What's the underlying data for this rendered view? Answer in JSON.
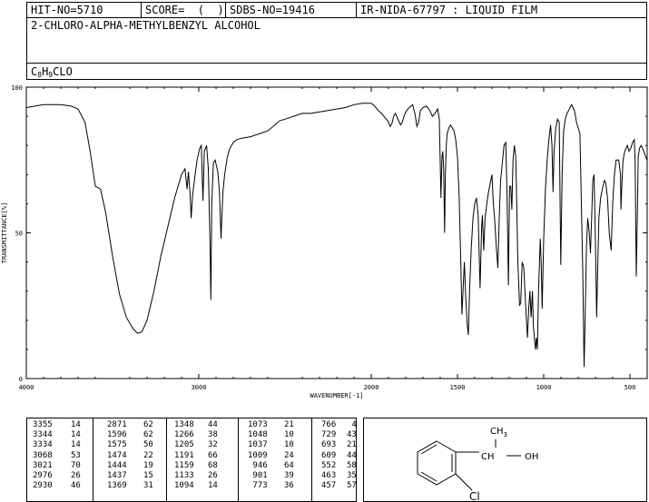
{
  "header": {
    "hit_no": "HIT-NO=5710",
    "score": "SCORE=  (  )",
    "sdbs_no": "SDBS-NO=19416",
    "ir_nida": "IR-NIDA-67797 : LIQUID FILM",
    "compound_name": "2-CHLORO-ALPHA-METHYLBENZYL ALCOHOL",
    "formula": {
      "c": "C",
      "c_count": "8",
      "h": "H",
      "h_count": "9",
      "rest": "CLO"
    }
  },
  "chart_data": {
    "type": "line",
    "xlabel": "WAVENUMBER[-1]",
    "ylabel": "TRANSMITTANCE[%]",
    "xlim": [
      4000,
      400
    ],
    "ylim": [
      0,
      100
    ],
    "x_ticks": [
      4000,
      3000,
      2000,
      1500,
      1000,
      500
    ],
    "y_ticks": [
      0,
      50,
      100
    ],
    "series": [
      {
        "points": [
          [
            4000,
            93
          ],
          [
            3900,
            94
          ],
          [
            3800,
            94
          ],
          [
            3740,
            93.5
          ],
          [
            3700,
            92.5
          ],
          [
            3660,
            88
          ],
          [
            3630,
            78
          ],
          [
            3600,
            66
          ],
          [
            3570,
            65
          ],
          [
            3540,
            57
          ],
          [
            3500,
            42
          ],
          [
            3460,
            29
          ],
          [
            3420,
            21
          ],
          [
            3380,
            17
          ],
          [
            3355,
            15.5
          ],
          [
            3330,
            16
          ],
          [
            3300,
            20
          ],
          [
            3260,
            30
          ],
          [
            3220,
            42
          ],
          [
            3180,
            52
          ],
          [
            3140,
            62
          ],
          [
            3100,
            70
          ],
          [
            3080,
            72
          ],
          [
            3068,
            65
          ],
          [
            3060,
            71
          ],
          [
            3050,
            63
          ],
          [
            3044,
            55
          ],
          [
            3036,
            63
          ],
          [
            3021,
            70
          ],
          [
            3010,
            75
          ],
          [
            2995,
            79
          ],
          [
            2985,
            80
          ],
          [
            2976,
            61
          ],
          [
            2968,
            78
          ],
          [
            2955,
            80
          ],
          [
            2945,
            72
          ],
          [
            2935,
            48
          ],
          [
            2930,
            27
          ],
          [
            2925,
            60
          ],
          [
            2915,
            74
          ],
          [
            2905,
            75
          ],
          [
            2890,
            71
          ],
          [
            2880,
            64
          ],
          [
            2871,
            48
          ],
          [
            2866,
            56
          ],
          [
            2860,
            64
          ],
          [
            2850,
            70
          ],
          [
            2835,
            76
          ],
          [
            2820,
            79
          ],
          [
            2800,
            81
          ],
          [
            2780,
            82
          ],
          [
            2750,
            82.5
          ],
          [
            2700,
            83
          ],
          [
            2650,
            84
          ],
          [
            2600,
            85
          ],
          [
            2560,
            87
          ],
          [
            2530,
            88.5
          ],
          [
            2500,
            89
          ],
          [
            2450,
            90
          ],
          [
            2400,
            91
          ],
          [
            2350,
            91
          ],
          [
            2300,
            91.5
          ],
          [
            2250,
            92
          ],
          [
            2200,
            92.5
          ],
          [
            2150,
            93
          ],
          [
            2100,
            94
          ],
          [
            2050,
            94.5
          ],
          [
            2000,
            94.5
          ],
          [
            1980,
            93.5
          ],
          [
            1960,
            92
          ],
          [
            1940,
            91
          ],
          [
            1920,
            89.5
          ],
          [
            1905,
            88.5
          ],
          [
            1890,
            86.5
          ],
          [
            1880,
            87.5
          ],
          [
            1870,
            90
          ],
          [
            1860,
            91
          ],
          [
            1845,
            89
          ],
          [
            1830,
            87
          ],
          [
            1820,
            88
          ],
          [
            1810,
            90
          ],
          [
            1800,
            91.5
          ],
          [
            1780,
            93
          ],
          [
            1760,
            94
          ],
          [
            1745,
            90.5
          ],
          [
            1735,
            86.5
          ],
          [
            1725,
            88
          ],
          [
            1715,
            92
          ],
          [
            1700,
            93
          ],
          [
            1680,
            93.5
          ],
          [
            1660,
            92
          ],
          [
            1645,
            90
          ],
          [
            1630,
            91
          ],
          [
            1615,
            92.5
          ],
          [
            1605,
            89
          ],
          [
            1596,
            62
          ],
          [
            1590,
            76
          ],
          [
            1585,
            78
          ],
          [
            1580,
            72
          ],
          [
            1575,
            50
          ],
          [
            1570,
            70
          ],
          [
            1565,
            80
          ],
          [
            1560,
            84
          ],
          [
            1550,
            86
          ],
          [
            1540,
            87
          ],
          [
            1530,
            86
          ],
          [
            1520,
            85
          ],
          [
            1510,
            82
          ],
          [
            1500,
            76
          ],
          [
            1490,
            62
          ],
          [
            1480,
            38
          ],
          [
            1474,
            22
          ],
          [
            1468,
            30
          ],
          [
            1460,
            40
          ],
          [
            1452,
            28
          ],
          [
            1444,
            19
          ],
          [
            1437,
            15
          ],
          [
            1430,
            30
          ],
          [
            1420,
            45
          ],
          [
            1410,
            55
          ],
          [
            1400,
            60
          ],
          [
            1390,
            62
          ],
          [
            1380,
            56
          ],
          [
            1369,
            31
          ],
          [
            1360,
            52
          ],
          [
            1355,
            56
          ],
          [
            1348,
            44
          ],
          [
            1340,
            55
          ],
          [
            1330,
            60
          ],
          [
            1320,
            64
          ],
          [
            1310,
            67
          ],
          [
            1300,
            70
          ],
          [
            1292,
            60
          ],
          [
            1285,
            55
          ],
          [
            1275,
            45
          ],
          [
            1266,
            38
          ],
          [
            1258,
            55
          ],
          [
            1250,
            68
          ],
          [
            1240,
            74
          ],
          [
            1230,
            80
          ],
          [
            1220,
            81
          ],
          [
            1212,
            62
          ],
          [
            1205,
            32
          ],
          [
            1198,
            66
          ],
          [
            1191,
            66
          ],
          [
            1185,
            58
          ],
          [
            1178,
            75
          ],
          [
            1170,
            80
          ],
          [
            1162,
            76
          ],
          [
            1159,
            68
          ],
          [
            1150,
            40
          ],
          [
            1140,
            25
          ],
          [
            1133,
            26
          ],
          [
            1125,
            40
          ],
          [
            1115,
            38
          ],
          [
            1105,
            25
          ],
          [
            1094,
            14
          ],
          [
            1087,
            24
          ],
          [
            1080,
            30
          ],
          [
            1073,
            21
          ],
          [
            1065,
            30
          ],
          [
            1060,
            18
          ],
          [
            1048,
            10
          ],
          [
            1042,
            14
          ],
          [
            1037,
            10
          ],
          [
            1030,
            30
          ],
          [
            1020,
            48
          ],
          [
            1015,
            40
          ],
          [
            1009,
            24
          ],
          [
            1000,
            48
          ],
          [
            990,
            65
          ],
          [
            980,
            75
          ],
          [
            970,
            82
          ],
          [
            960,
            87
          ],
          [
            952,
            80
          ],
          [
            946,
            64
          ],
          [
            940,
            78
          ],
          [
            930,
            86
          ],
          [
            920,
            89
          ],
          [
            910,
            88
          ],
          [
            901,
            39
          ],
          [
            893,
            70
          ],
          [
            885,
            85
          ],
          [
            875,
            89
          ],
          [
            865,
            91
          ],
          [
            855,
            92
          ],
          [
            848,
            93
          ],
          [
            838,
            94
          ],
          [
            830,
            93
          ],
          [
            822,
            92
          ],
          [
            816,
            90
          ],
          [
            810,
            88
          ],
          [
            800,
            86
          ],
          [
            790,
            84
          ],
          [
            773,
            36
          ],
          [
            768,
            12
          ],
          [
            766,
            4
          ],
          [
            760,
            20
          ],
          [
            752,
            45
          ],
          [
            745,
            55
          ],
          [
            736,
            50
          ],
          [
            729,
            43
          ],
          [
            722,
            55
          ],
          [
            715,
            68
          ],
          [
            708,
            70
          ],
          [
            698,
            40
          ],
          [
            693,
            21
          ],
          [
            688,
            35
          ],
          [
            680,
            55
          ],
          [
            670,
            62
          ],
          [
            660,
            65
          ],
          [
            648,
            68
          ],
          [
            640,
            67
          ],
          [
            630,
            62
          ],
          [
            620,
            50
          ],
          [
            609,
            44
          ],
          [
            600,
            60
          ],
          [
            590,
            70
          ],
          [
            580,
            75
          ],
          [
            565,
            75
          ],
          [
            555,
            70
          ],
          [
            552,
            58
          ],
          [
            548,
            65
          ],
          [
            540,
            75
          ],
          [
            530,
            78
          ],
          [
            515,
            80
          ],
          [
            505,
            78
          ],
          [
            495,
            79
          ],
          [
            485,
            81
          ],
          [
            475,
            82
          ],
          [
            470,
            75
          ],
          [
            463,
            35
          ],
          [
            457,
            57
          ],
          [
            452,
            76
          ],
          [
            445,
            79
          ],
          [
            435,
            80
          ],
          [
            420,
            78
          ],
          [
            408,
            76
          ],
          [
            400,
            75
          ]
        ]
      }
    ]
  },
  "peak_table": {
    "columns": [
      [
        "3355",
        "3344",
        "3334",
        "3068",
        "3021",
        "2976",
        "2930"
      ],
      [
        "14",
        "14",
        "14",
        "53",
        "70",
        "26",
        "46"
      ],
      [
        "2871",
        "1596",
        "1575",
        "1474",
        "1444",
        "1437",
        "1369"
      ],
      [
        "62",
        "62",
        "50",
        "22",
        "19",
        "15",
        "31"
      ],
      [
        "1348",
        "1266",
        "1205",
        "1191",
        "1159",
        "1133",
        "1094"
      ],
      [
        "44",
        "38",
        "32",
        "66",
        "68",
        "26",
        "14"
      ],
      [
        "1073",
        "1048",
        "1037",
        "1009",
        "946",
        "901",
        "773"
      ],
      [
        "21",
        "10",
        "10",
        "24",
        "64",
        "39",
        "36"
      ],
      [
        "766",
        "729",
        "693",
        "609",
        "552",
        "463",
        "457"
      ],
      [
        "4",
        "43",
        "21",
        "44",
        "58",
        "35",
        "57"
      ]
    ]
  },
  "structure": {
    "methyl_label": "CH",
    "methyl_subscript": "3",
    "ch_label": "CH",
    "oh_label": "OH",
    "cl_label": "Cl"
  }
}
